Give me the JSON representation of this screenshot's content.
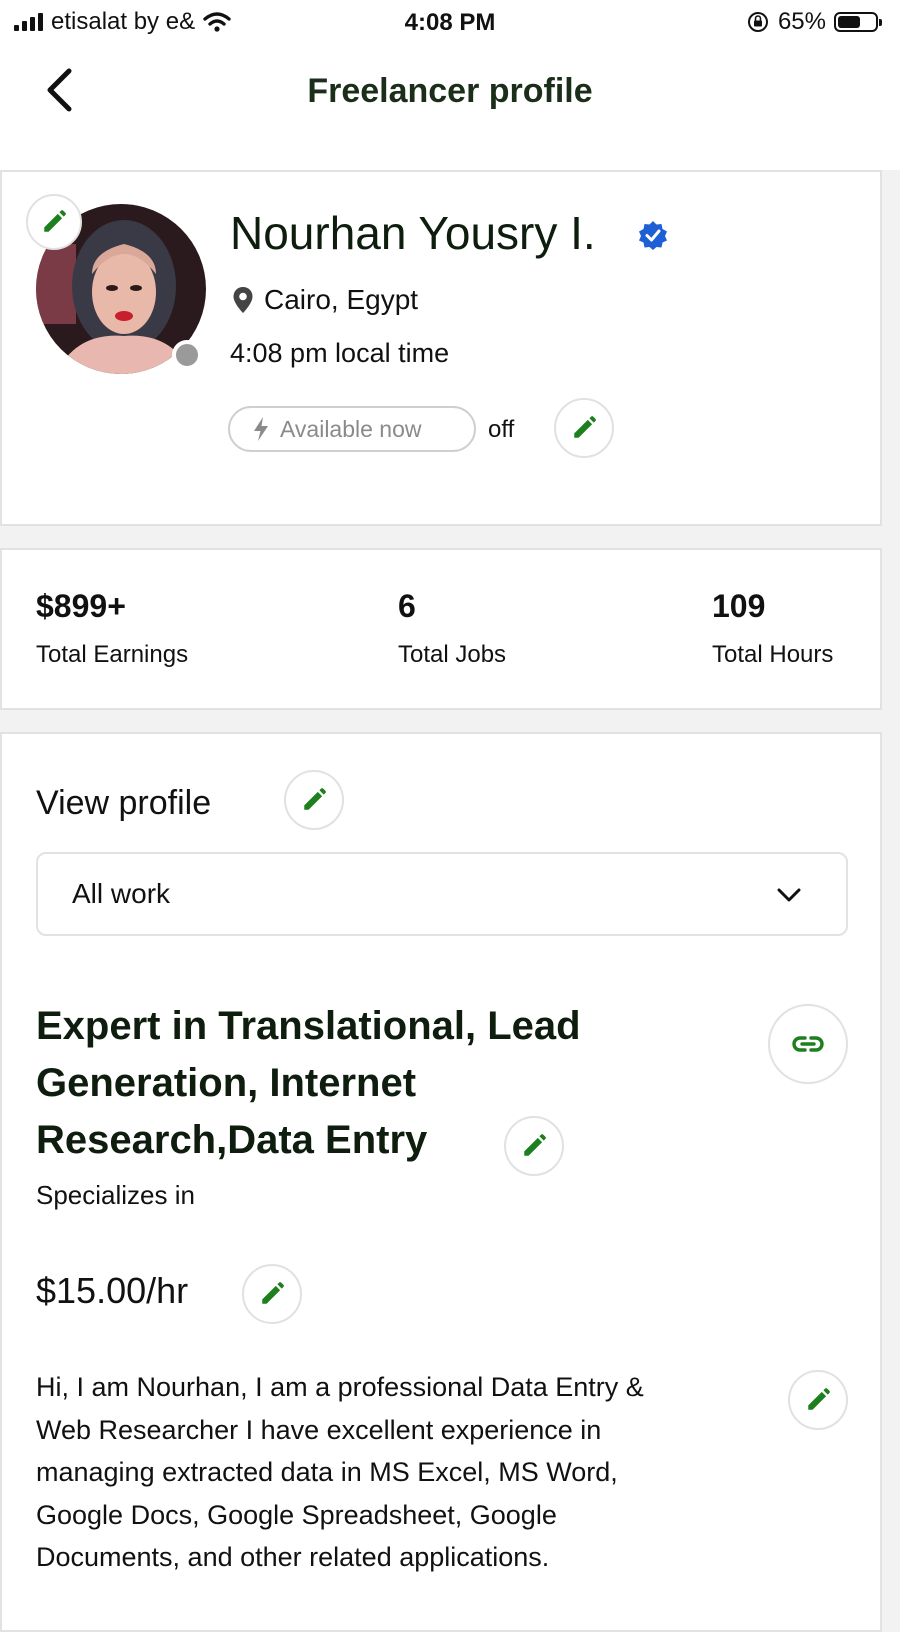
{
  "status_bar": {
    "carrier": "etisalat by e&",
    "time": "4:08 PM",
    "battery_percent": "65%",
    "battery_level": 0.65
  },
  "nav": {
    "title": "Freelancer profile",
    "back_icon": "chevron-left-icon"
  },
  "profile": {
    "name": "Nourhan Yousry I.",
    "location": "Cairo, Egypt",
    "local_time": "4:08 pm local time",
    "availability_label": "Available now",
    "availability_state": "off",
    "online_status_color": "#9a9a9a",
    "verified_color": "#1f5fd6"
  },
  "stats": [
    {
      "value": "$899+",
      "label": "Total Earnings"
    },
    {
      "value": "6",
      "label": "Total Jobs"
    },
    {
      "value": "109",
      "label": "Total Hours"
    }
  ],
  "details": {
    "view_profile_label": "View profile",
    "filter_selected": "All work",
    "headline_lines": [
      "Expert in Translational, Lead",
      "Generation, Internet",
      "Research,Data Entry"
    ],
    "specializes_label": "Specializes in",
    "rate": "$15.00/hr",
    "bio_lines": [
      "Hi, I am Nourhan, I am a professional Data Entry &",
      "Web Researcher I have excellent experience in",
      "managing extracted data in MS Excel, MS Word,",
      "Google Docs, Google Spreadsheet, Google",
      "Documents, and other related applications."
    ]
  },
  "colors": {
    "accent_green": "#1e7f1e",
    "title_dark_green": "#1a2e1a"
  }
}
